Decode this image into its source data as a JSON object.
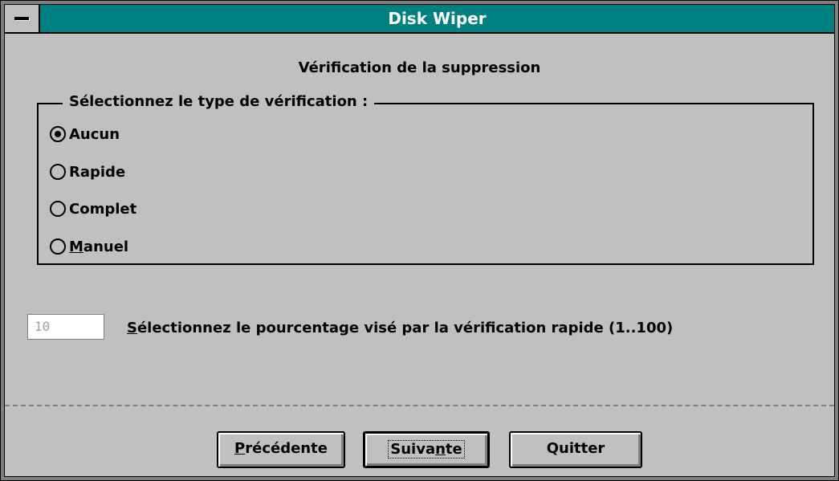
{
  "window": {
    "title": "Disk Wiper"
  },
  "page": {
    "subtitle": "Vérification de la suppression"
  },
  "group": {
    "legend": "Sélectionnez le type de vérification :",
    "options": [
      {
        "label": "Aucun",
        "checked": true
      },
      {
        "label": "Rapide",
        "checked": false
      },
      {
        "label": "Complet",
        "checked": false
      },
      {
        "label_prefix": "",
        "label_accel": "M",
        "label_rest": "anuel",
        "checked": false
      }
    ]
  },
  "percentage": {
    "value": "10",
    "label_accel": "S",
    "label_rest": "électionnez le pourcentage visé par la vérification rapide (1..100)"
  },
  "buttons": {
    "previous": {
      "accel": "P",
      "rest": "récédente"
    },
    "next": {
      "before": "Suiva",
      "accel": "n",
      "after": "te"
    },
    "quit": "Quitter"
  },
  "colors": {
    "titlebar": "#008080",
    "face": "#c0c0c0"
  }
}
